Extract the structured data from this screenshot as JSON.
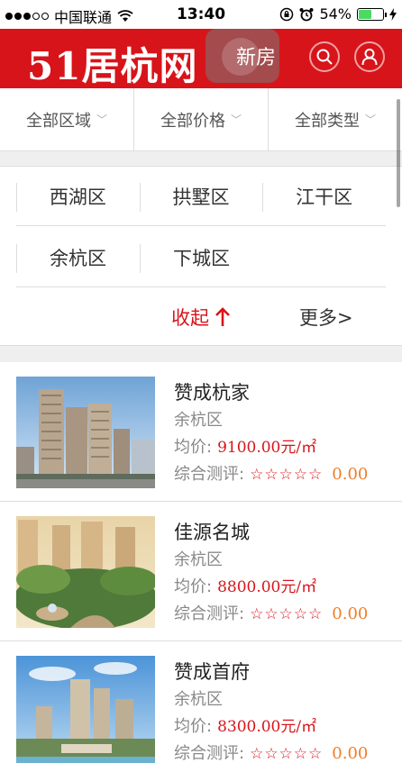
{
  "status_bar": {
    "carrier": "中国联通",
    "time": "13:40",
    "battery": "54%",
    "battery_level": 0.54
  },
  "header": {
    "logo": "51居杭网",
    "new_house_label": "新房",
    "brand_color": "#d7141a"
  },
  "filters": [
    {
      "label": "全部区域"
    },
    {
      "label": "全部价格"
    },
    {
      "label": "全部类型"
    }
  ],
  "districts": [
    "西湖区",
    "拱墅区",
    "江干区",
    "余杭区",
    "下城区"
  ],
  "panel": {
    "collapse_label": "收起",
    "more_label": "更多>"
  },
  "listings": [
    {
      "name": "赞成杭家",
      "district": "余杭区",
      "price_label": "均价:",
      "price": "9100.00元/㎡",
      "rating_label": "综合测评:",
      "stars": "☆☆☆☆☆",
      "score": "0.00"
    },
    {
      "name": "佳源名城",
      "district": "余杭区",
      "price_label": "均价:",
      "price": "8800.00元/㎡",
      "rating_label": "综合测评:",
      "stars": "☆☆☆☆☆",
      "score": "0.00"
    },
    {
      "name": "赞成首府",
      "district": "余杭区",
      "price_label": "均价:",
      "price": "8300.00元/㎡",
      "rating_label": "综合测评:",
      "stars": "☆☆☆☆☆",
      "score": "0.00"
    }
  ]
}
